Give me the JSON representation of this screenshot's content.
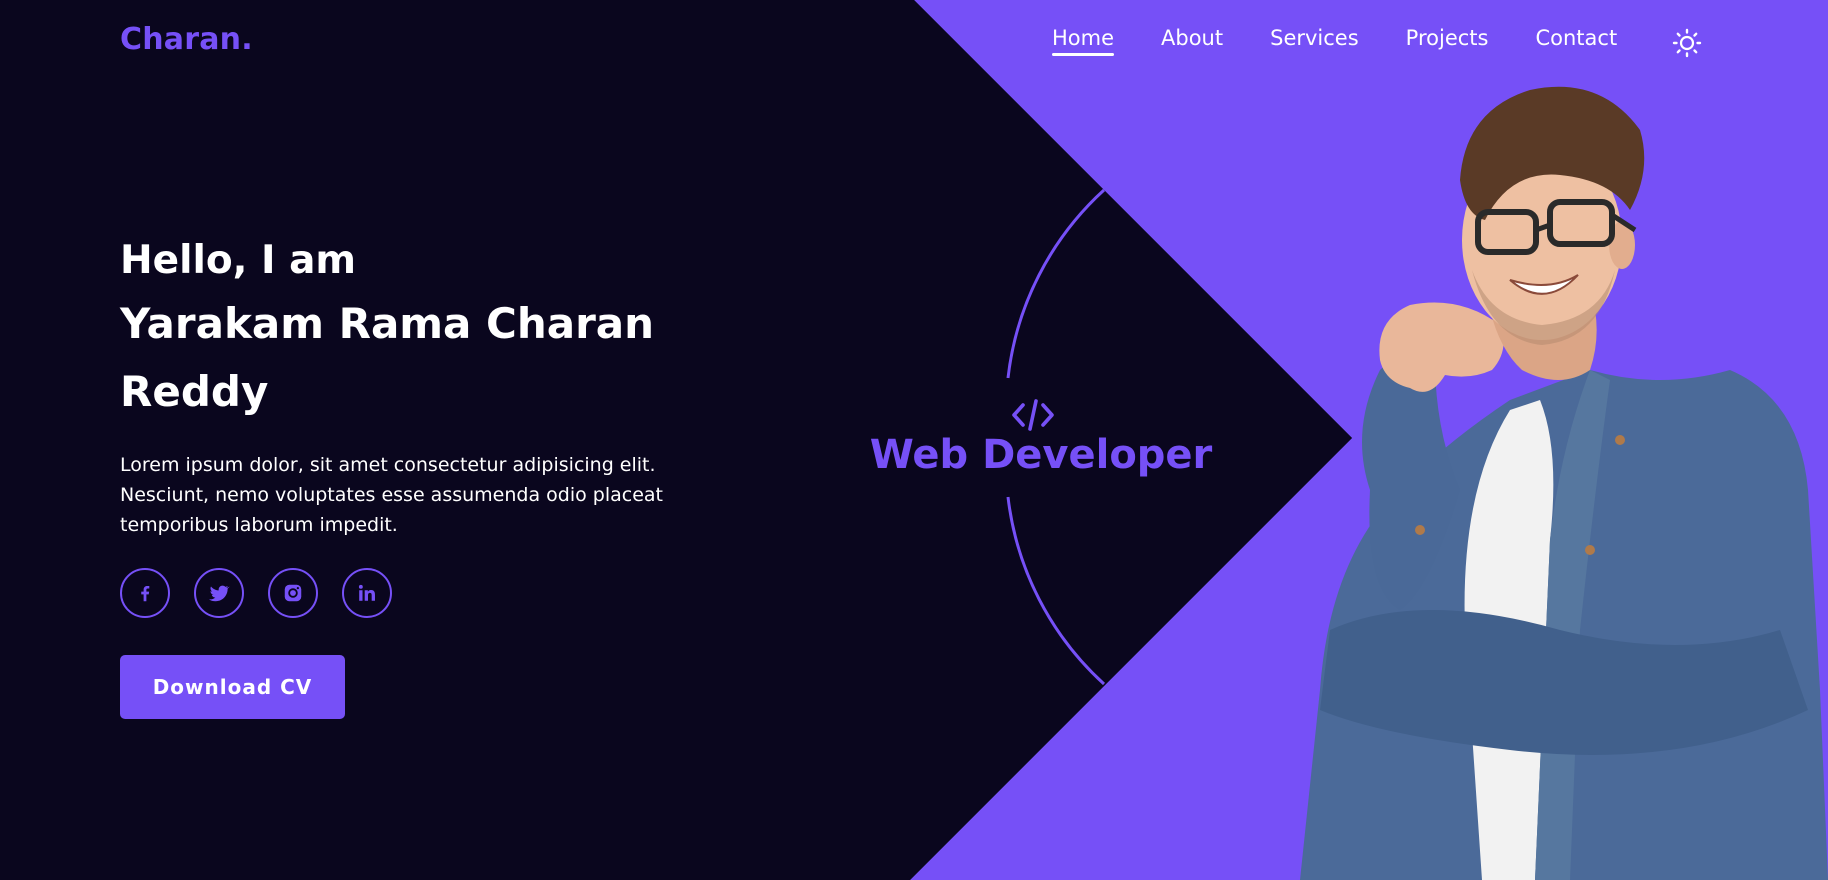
{
  "brand": {
    "logo": "Charan."
  },
  "nav": {
    "items": [
      {
        "label": "Home",
        "active": true
      },
      {
        "label": "About",
        "active": false
      },
      {
        "label": "Services",
        "active": false
      },
      {
        "label": "Projects",
        "active": false
      },
      {
        "label": "Contact",
        "active": false
      }
    ],
    "theme_toggle_icon": "sun-icon"
  },
  "hero": {
    "greeting": "Hello, I am",
    "name": "Yarakam Rama Charan Reddy",
    "description": "Lorem ipsum dolor, sit amet consectetur adipisicing elit. Nesciunt, nemo voluptates esse assumenda odio placeat temporibus laborum impedit.",
    "socials": [
      "facebook-icon",
      "twitter-icon",
      "instagram-icon",
      "linkedin-icon"
    ],
    "cta_label": "Download CV"
  },
  "role": {
    "icon": "code-icon",
    "title": "Web Developer"
  },
  "colors": {
    "background": "#0a061e",
    "accent": "#7650f7",
    "text": "#ffffff"
  }
}
